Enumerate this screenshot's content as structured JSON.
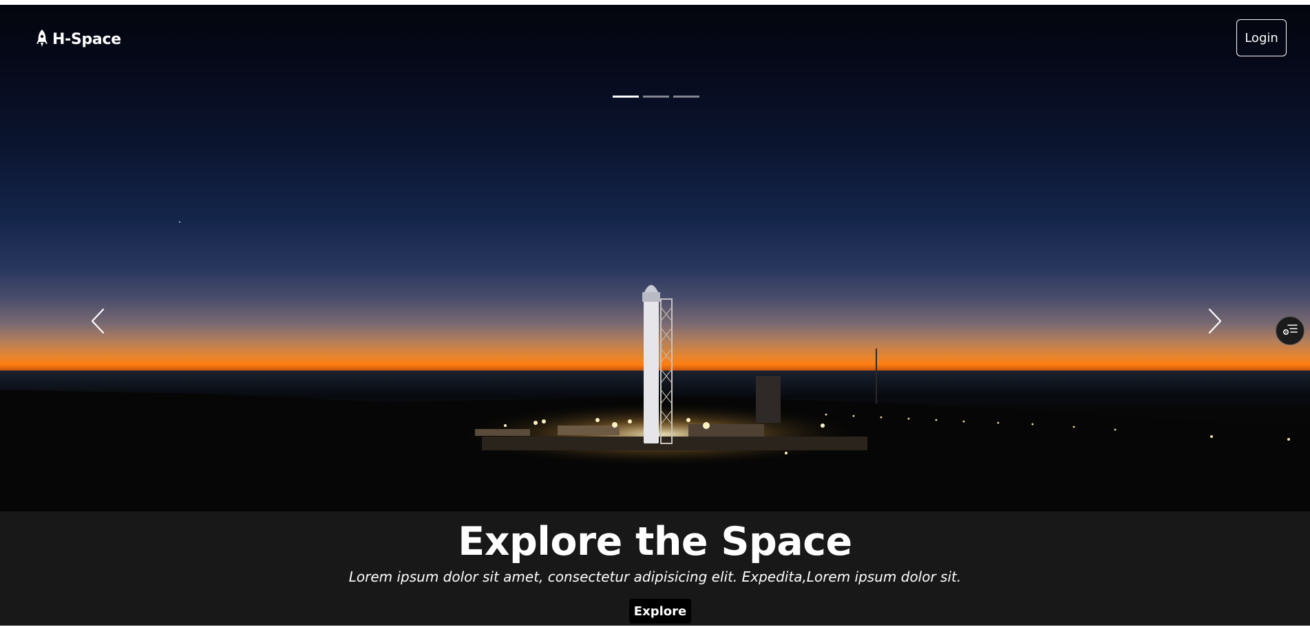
{
  "header": {
    "brand": "H-Space",
    "login_label": "Login"
  },
  "carousel": {
    "slide_count": 3,
    "active_index": 0,
    "prev_icon": "chevron-left-icon",
    "next_icon": "chevron-right-icon"
  },
  "hero": {
    "title": "Explore the Space",
    "subtitle": "Lorem ipsum dolor sit amet, consectetur adipisicing elit. Expedita,Lorem ipsum dolor sit.",
    "cta_label": "Explore"
  },
  "floating": {
    "icon": "settings-list-icon"
  },
  "colors": {
    "caption_bg": "#181818",
    "button_bg": "#000000",
    "text": "#ffffff",
    "horizon_orange": "#ff7e12"
  }
}
